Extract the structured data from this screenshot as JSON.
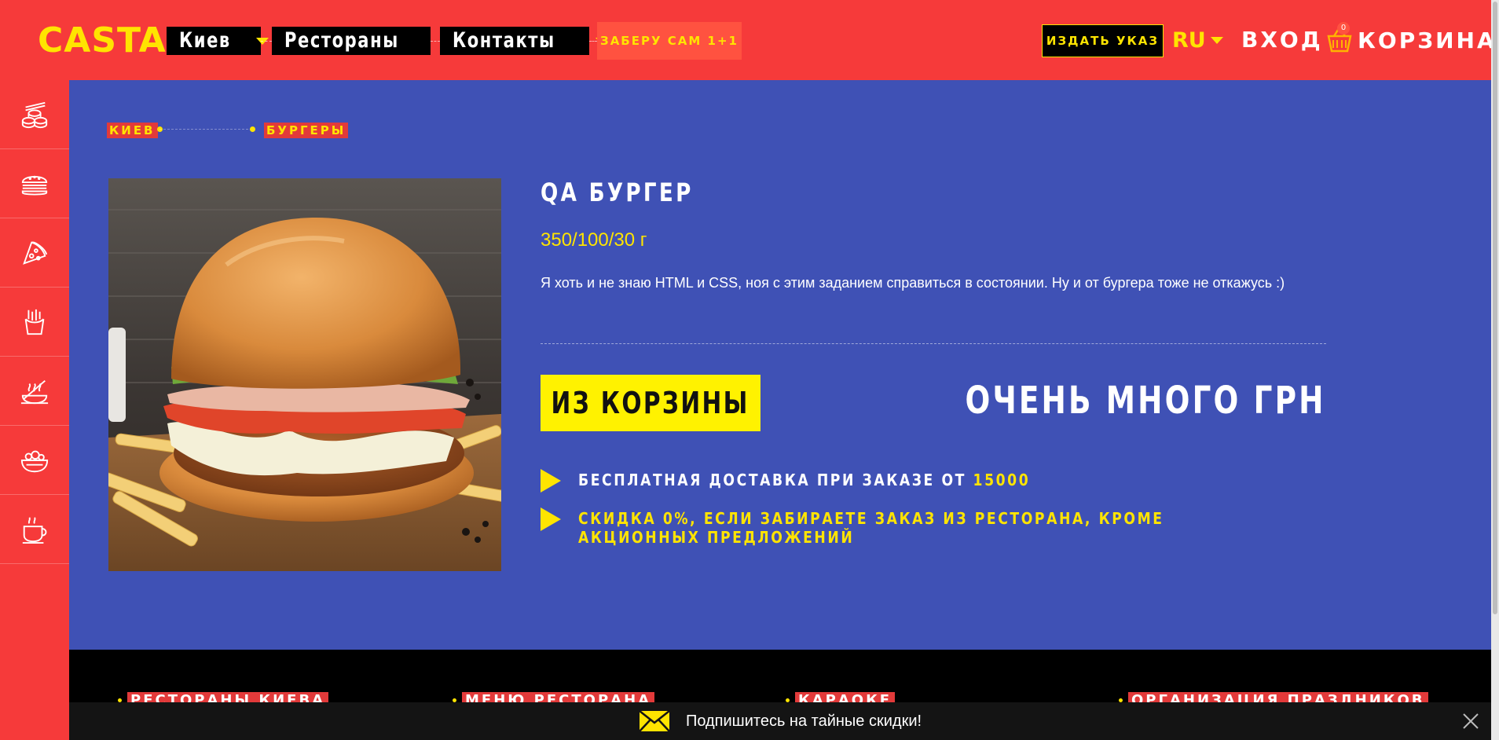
{
  "header": {
    "logo": "CASTA",
    "nav": [
      {
        "label": "Киев",
        "icon": "chevron-down-icon"
      },
      {
        "label": "Рестораны",
        "icon": "chevron-down-icon"
      },
      {
        "label": "Контакты",
        "icon": "chevron-down-icon"
      }
    ],
    "pickup": "Заберу сам 1+1",
    "order_button": "Издать указ",
    "language": "RU",
    "login": "Вход",
    "cart_label": "Корзина",
    "cart_count": "0"
  },
  "sidebar": {
    "items": [
      {
        "name": "sushi",
        "icon": "sushi-icon"
      },
      {
        "name": "burgers",
        "icon": "burger-icon"
      },
      {
        "name": "pizza",
        "icon": "pizza-icon"
      },
      {
        "name": "fries",
        "icon": "fries-icon"
      },
      {
        "name": "hot-dishes",
        "icon": "hot-dish-icon"
      },
      {
        "name": "salads",
        "icon": "salad-icon"
      },
      {
        "name": "drinks",
        "icon": "coffee-cup-icon"
      }
    ]
  },
  "breadcrumb": {
    "items": [
      "Киев",
      "Бургеры"
    ]
  },
  "product": {
    "title": "QA бургер",
    "weight": "350/100/30 г",
    "description": "Я хоть и не знаю HTML и CSS, ноя с этим заданием справиться в состоянии. Ну и от бургера тоже не откажусь :)",
    "remove_button": "Из корзины",
    "price": "Очень много грн",
    "image_alt": "burger photo"
  },
  "info": {
    "delivery_text": "Бесплатная доставка при заказе от",
    "delivery_amount": "15000",
    "discount_text": "Скидка 0%, если забираете заказ из ресторана, кроме акционных предложений"
  },
  "footer": {
    "links": [
      "Рестораны Киева",
      "Меню ресторана",
      "Караоке",
      "Организация праздников"
    ]
  },
  "subscribe": {
    "text": "Подпишитесь на тайные скидки!",
    "icon": "envelope-icon",
    "close_icon": "close-icon"
  },
  "colors": {
    "red": "#f63a3a",
    "blue": "#3f51b5",
    "yellow": "#ffe400",
    "black": "#000000"
  }
}
